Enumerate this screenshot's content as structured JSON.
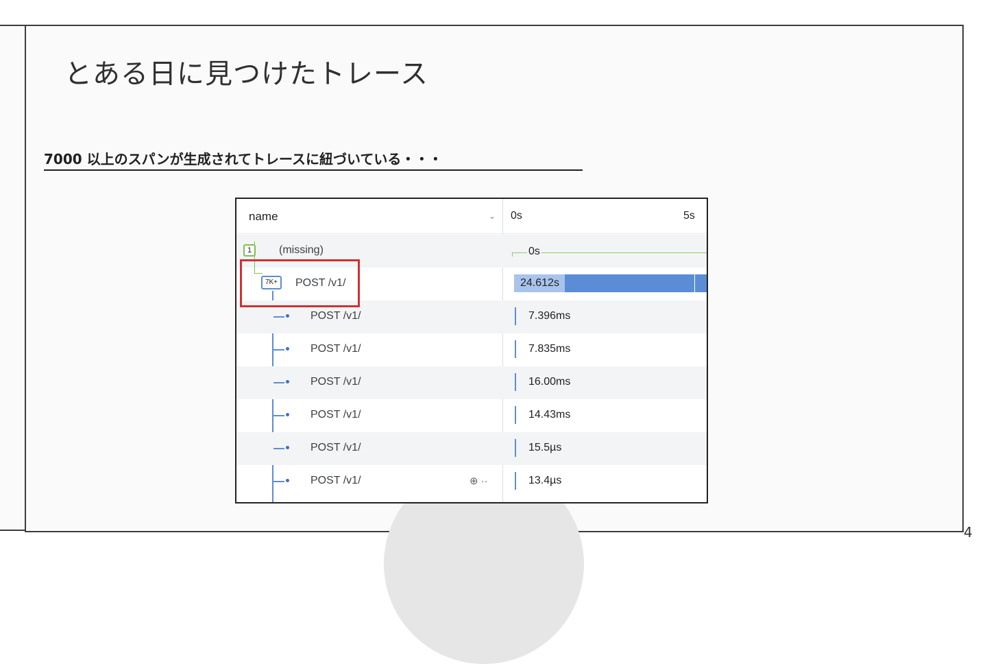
{
  "slide": {
    "title": "とある日に見つけたトレース",
    "subtitle": "7000 以上のスパンが生成されてトレースに紐づいている・・・",
    "page_number": "4"
  },
  "trace": {
    "header": {
      "name_label": "name",
      "time_start": "0s",
      "time_mark": "5s"
    },
    "root": {
      "badge": "1",
      "label": "(missing)",
      "duration": "0s"
    },
    "parent": {
      "badge": "7K+",
      "label": "POST /v1/",
      "duration": "24.612s"
    },
    "children": [
      {
        "label": "POST /v1/",
        "duration": "7.396ms"
      },
      {
        "label": "POST /v1/",
        "duration": "7.835ms"
      },
      {
        "label": "POST /v1/",
        "duration": "16.00ms"
      },
      {
        "label": "POST /v1/",
        "duration": "14.43ms"
      },
      {
        "label": "POST /v1/",
        "duration": "15.5µs"
      },
      {
        "label": "POST /v1/",
        "duration": "13.4µs"
      }
    ],
    "row_actions": "⊕ ··"
  },
  "colors": {
    "highlight": "#d32f2f",
    "span_blue": "#5b8dd6",
    "root_green": "#7cc151"
  }
}
